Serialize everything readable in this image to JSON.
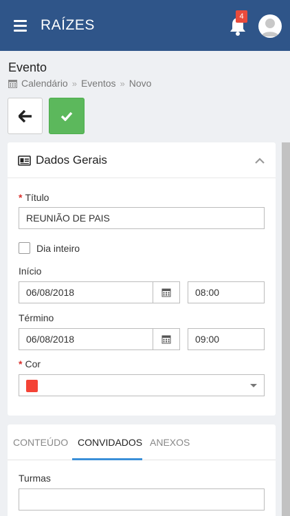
{
  "header": {
    "app_title": "RAÍZES",
    "notification_count": "4"
  },
  "page": {
    "title": "Evento",
    "breadcrumb": [
      "Calendário",
      "Eventos",
      "Novo"
    ]
  },
  "form": {
    "section_title": "Dados Gerais",
    "titulo_label": "Título",
    "titulo_value": "REUNIÃO DE PAIS",
    "dia_inteiro_label": "Dia inteiro",
    "inicio_label": "Início",
    "inicio_date": "06/08/2018",
    "inicio_time": "08:00",
    "termino_label": "Término",
    "termino_date": "06/08/2018",
    "termino_time": "09:00",
    "cor_label": "Cor",
    "cor_value": "#f44336"
  },
  "tabs": {
    "items": [
      "CONTEÚDO",
      "CONVIDADOS",
      "ANEXOS"
    ],
    "active": "CONVIDADOS"
  },
  "convidados": {
    "turmas_label": "Turmas",
    "turmas_value": ""
  },
  "colors": {
    "header_bg": "#2f5589",
    "save_button": "#5cb85c",
    "badge": "#e94b3c",
    "tab_accent": "#3a8fd8",
    "required": "#d9302c"
  }
}
